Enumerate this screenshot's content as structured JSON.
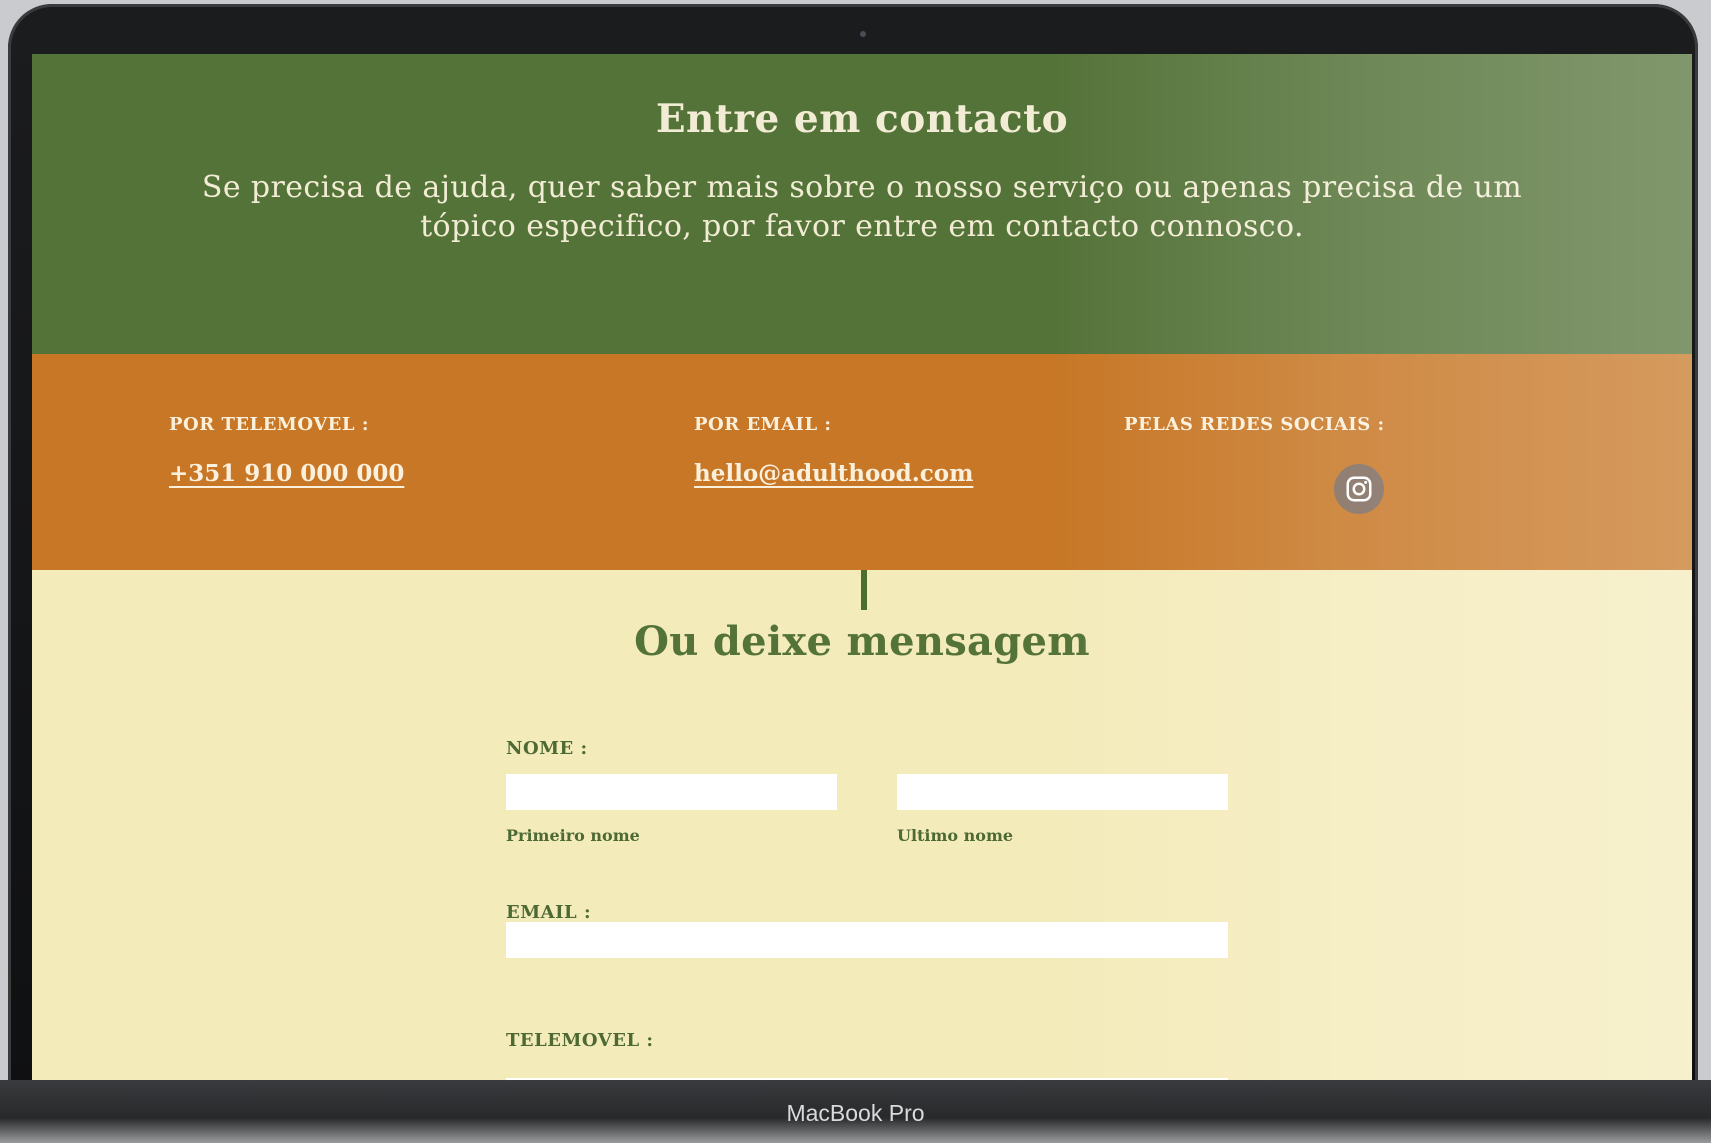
{
  "hero": {
    "title": "Entre em contacto",
    "description": "Se precisa de ajuda, quer saber mais sobre o nosso serviço  ou apenas precisa de um tópico especifico, por favor entre em contacto connosco."
  },
  "contacts": {
    "phone": {
      "label": "POR TELEMOVEL :",
      "value": "+351 910 000 000"
    },
    "email": {
      "label": "POR EMAIL :",
      "value": "hello@adulthood.com"
    },
    "social": {
      "label": "PELAS REDES SOCIAIS :",
      "icon": "instagram-icon"
    }
  },
  "form": {
    "title": "Ou deixe mensagem",
    "name_label": "NOME :",
    "first_name_hint": "Primeiro nome",
    "last_name_hint": "Ultimo nome",
    "email_label": "EMAIL :",
    "phone_label": "TELEMOVEL :"
  },
  "device": {
    "label": "MacBook Pro"
  },
  "colors": {
    "hero_bg": "#547339",
    "contacts_bg": "#c77726",
    "form_bg": "#f4ebbb",
    "accent_green": "#4d6a35",
    "cream_text": "#f2ecd4"
  }
}
